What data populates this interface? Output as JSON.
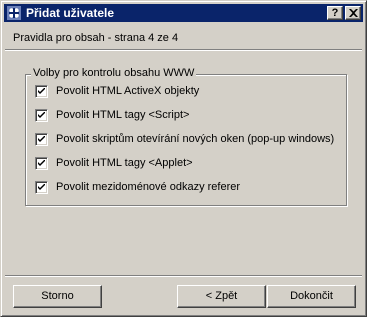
{
  "window": {
    "title": "Přidat uživatele",
    "help_label": "?",
    "close_icon": "close-icon",
    "app_icon": "users-icon"
  },
  "header": {
    "text": "Pravidla pro obsah - strana 4 ze 4"
  },
  "group": {
    "legend": "Volby pro kontrolu obsahu WWW",
    "options": [
      {
        "label": "Povolit HTML ActiveX objekty",
        "checked": true
      },
      {
        "label": "Povolit HTML tagy <Script>",
        "checked": true
      },
      {
        "label": "Povolit skriptům otevírání nových oken (pop-up windows)",
        "checked": true
      },
      {
        "label": "Povolit HTML tagy <Applet>",
        "checked": true
      },
      {
        "label": "Povolit mezidoménové odkazy referer",
        "checked": true
      }
    ]
  },
  "buttons": {
    "cancel": "Storno",
    "back": "< Zpět",
    "finish": "Dokončit"
  },
  "colors": {
    "titlebar": "#0a246a",
    "face": "#d4d0c8"
  }
}
